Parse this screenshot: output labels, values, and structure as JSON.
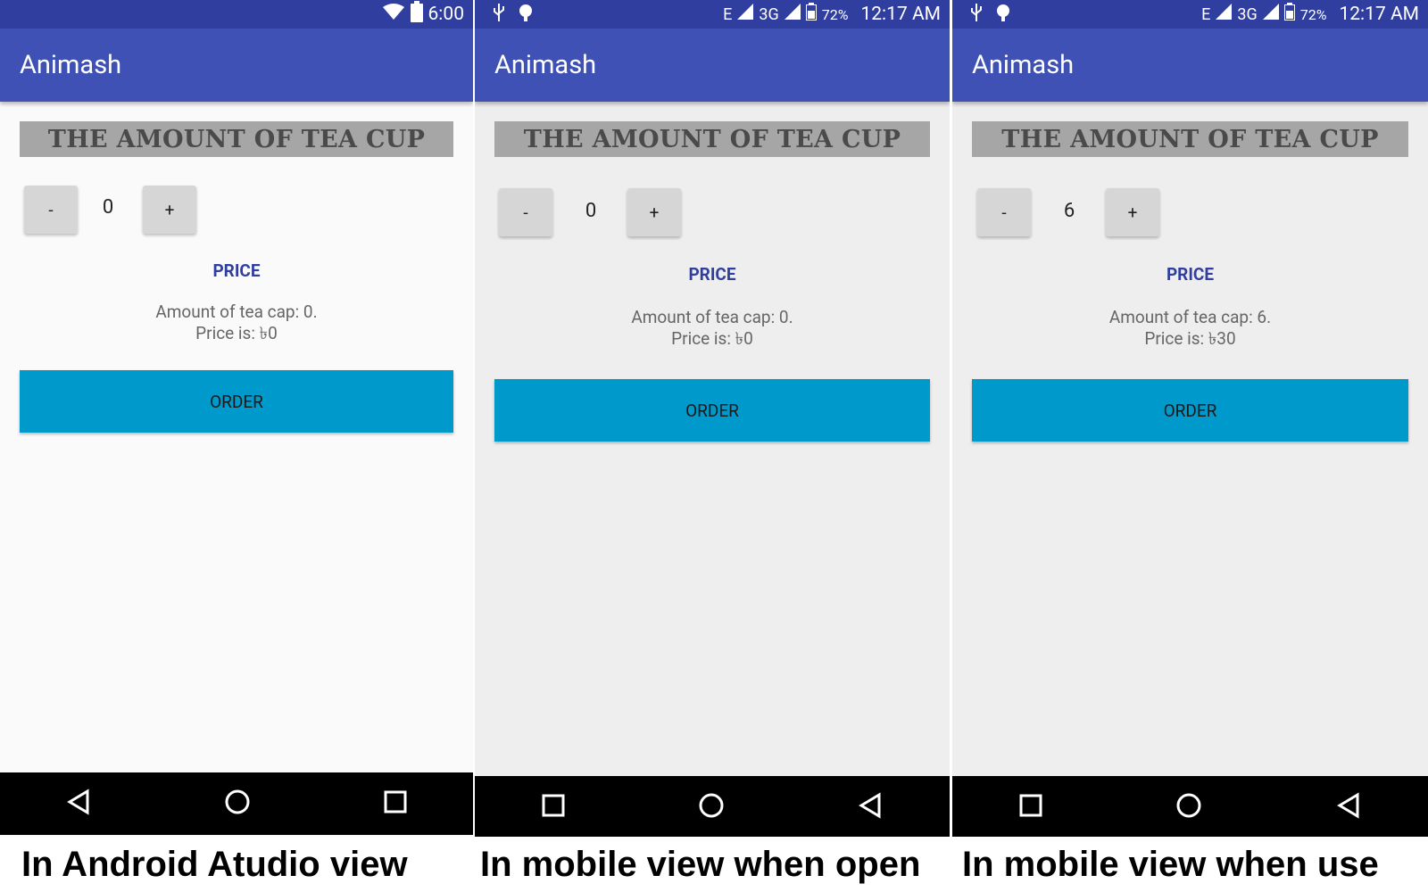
{
  "panels": [
    {
      "status": {
        "time": "6:00"
      },
      "app_title": "Animash",
      "heading": "THE AMOUNT OF TEA CUP",
      "stepper": {
        "decrement": "-",
        "quantity": "0",
        "increment": "+"
      },
      "price_label": "PRICE",
      "summary_line1": "Amount of tea cap: 0.",
      "summary_line2": "Price is: ৳0",
      "order_label": "ORDER",
      "nav_order": [
        "back-icon",
        "home-icon",
        "recents-icon"
      ]
    },
    {
      "status": {
        "network": "E",
        "network2": "3G",
        "battery": "72%",
        "time": "12:17 AM"
      },
      "app_title": "Animash",
      "heading": "THE AMOUNT OF TEA CUP",
      "stepper": {
        "decrement": "-",
        "quantity": "0",
        "increment": "+"
      },
      "price_label": "PRICE",
      "summary_line1": "Amount of tea cap: 0.",
      "summary_line2": "Price is: ৳0",
      "order_label": "ORDER",
      "nav_order": [
        "recents-icon",
        "home-icon",
        "back-icon"
      ]
    },
    {
      "status": {
        "network": "E",
        "network2": "3G",
        "battery": "72%",
        "time": "12:17 AM"
      },
      "app_title": "Animash",
      "heading": "THE AMOUNT OF TEA CUP",
      "stepper": {
        "decrement": "-",
        "quantity": "6",
        "increment": "+"
      },
      "price_label": "PRICE",
      "summary_line1": "Amount of tea cap: 6.",
      "summary_line2": "Price is: ৳30",
      "order_label": "ORDER",
      "nav_order": [
        "recents-icon",
        "home-icon",
        "back-icon"
      ]
    }
  ],
  "captions": [
    "In Android Atudio view",
    "In mobile view when open",
    "In mobile view when use"
  ],
  "colors": {
    "status_bar": "#303f9f",
    "app_bar": "#3f51b5",
    "heading_bg": "#a6a6a6",
    "order_button": "#0099cc",
    "price_label": "#303f9f"
  }
}
